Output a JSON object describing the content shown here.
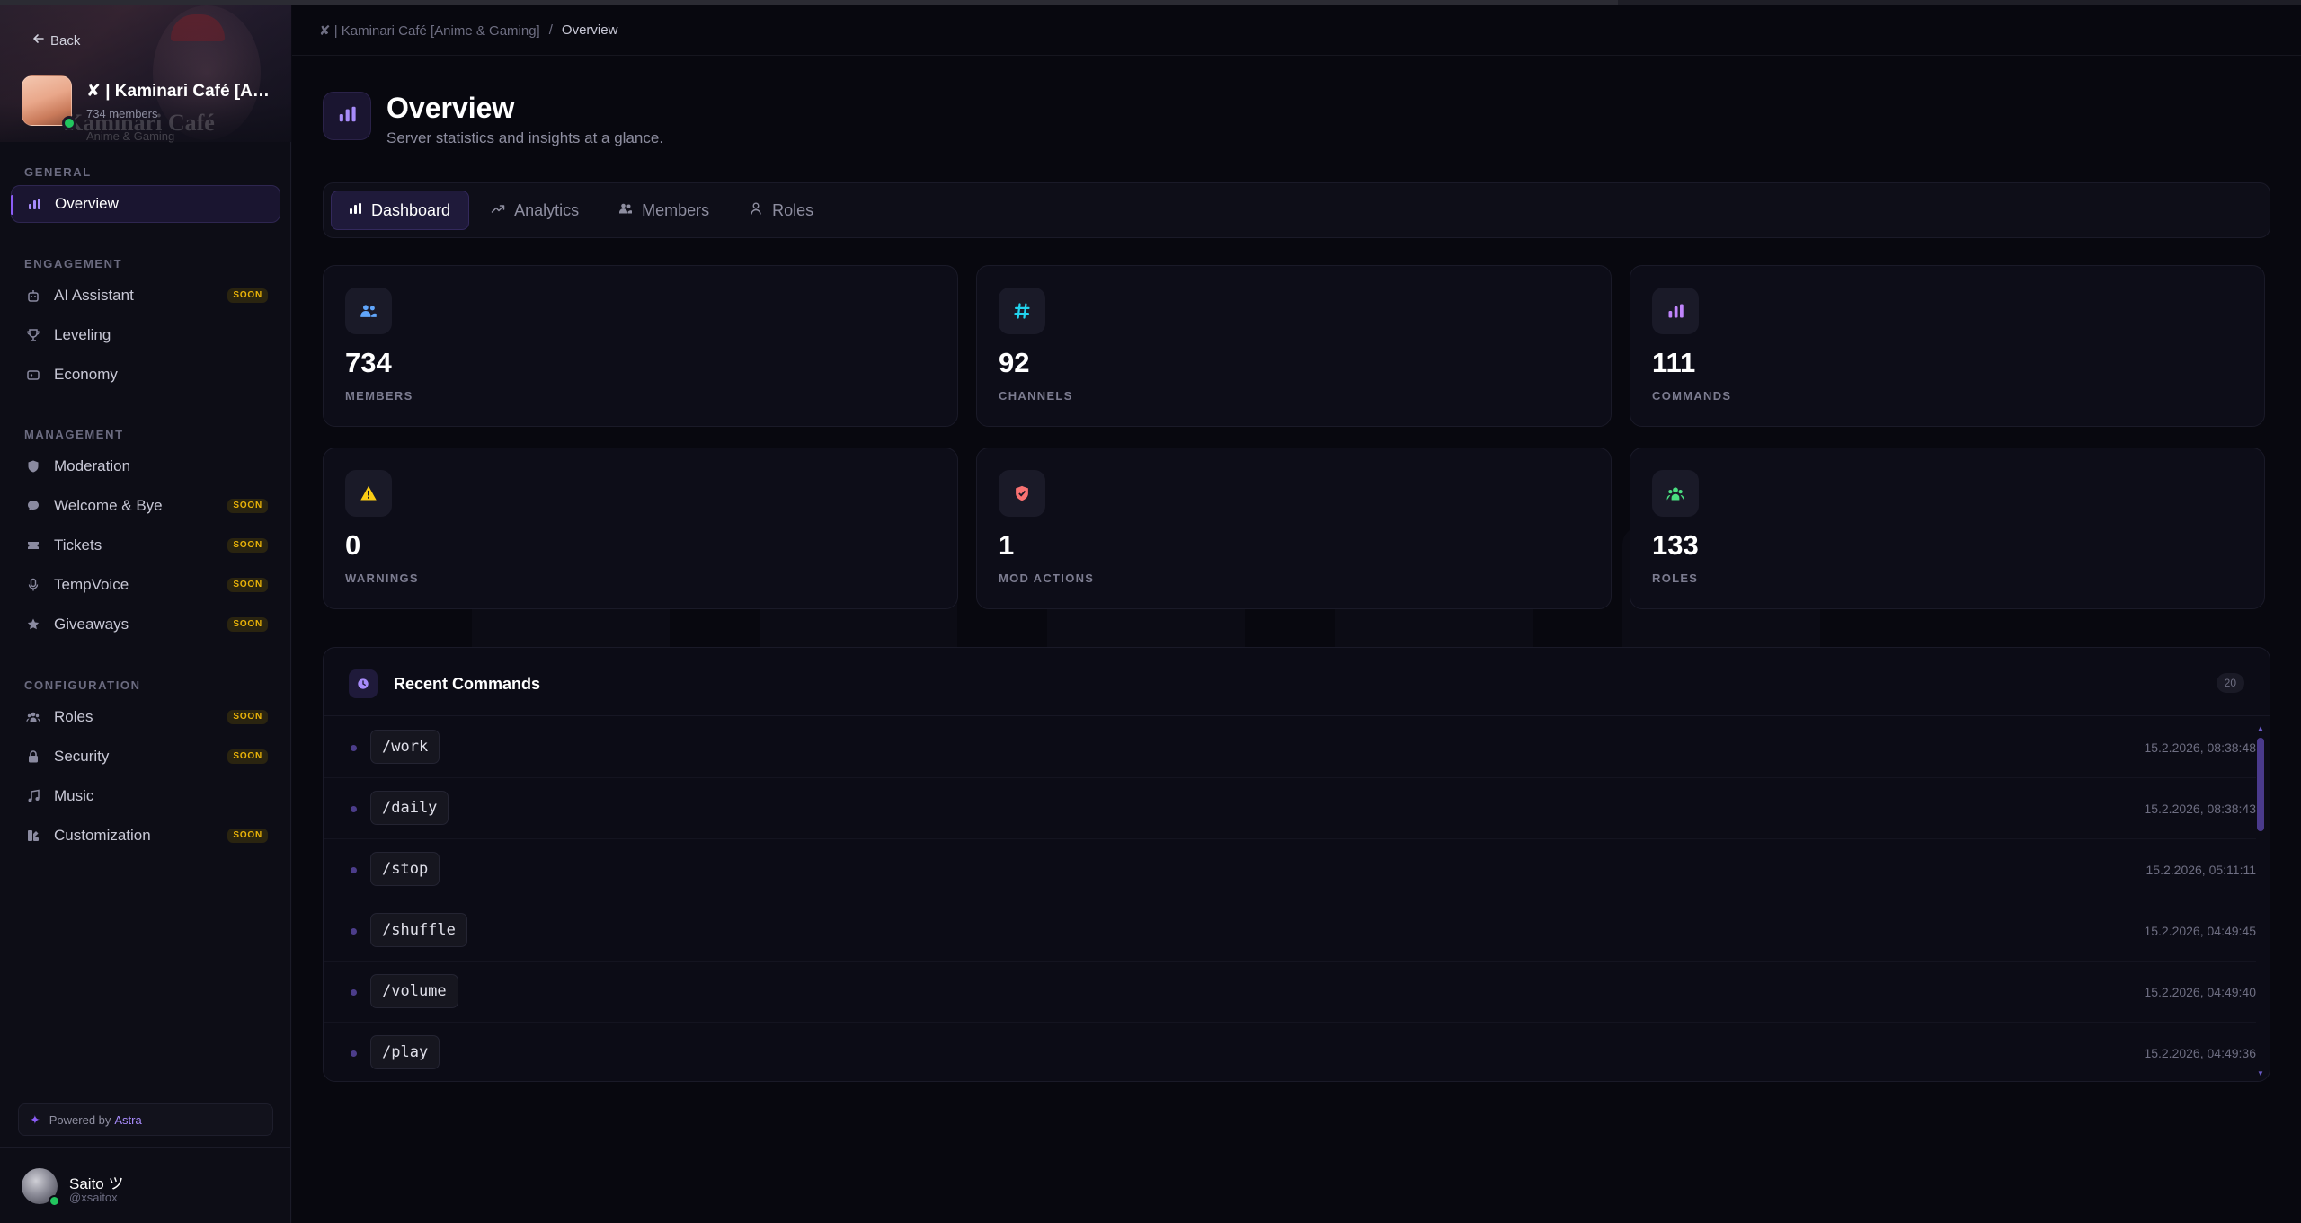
{
  "sidebar": {
    "back_label": "Back",
    "server": {
      "name": "✘ | Kaminari Café [An...",
      "members": "734 members",
      "banner_ghost_title": "Kaminari Café",
      "banner_ghost_subtitle": "Anime & Gaming"
    },
    "sections": {
      "general": "GENERAL",
      "engagement": "ENGAGEMENT",
      "management": "MANAGEMENT",
      "configuration": "CONFIGURATION"
    },
    "items": {
      "overview": "Overview",
      "ai_assistant": "AI Assistant",
      "leveling": "Leveling",
      "economy": "Economy",
      "moderation": "Moderation",
      "welcome_bye": "Welcome & Bye",
      "tickets": "Tickets",
      "tempvoice": "TempVoice",
      "giveaways": "Giveaways",
      "roles": "Roles",
      "security": "Security",
      "music": "Music",
      "customization": "Customization"
    },
    "soon_label": "SOON",
    "powered_prefix": "Powered by",
    "powered_brand": "Astra",
    "user": {
      "name": "Saito ツ",
      "handle": "@xsaitox"
    }
  },
  "breadcrumb": {
    "server": "✘ | Kaminari Café [Anime & Gaming]",
    "separator": "/",
    "current": "Overview"
  },
  "page": {
    "title": "Overview",
    "subtitle": "Server statistics and insights at a glance."
  },
  "tabs": {
    "dashboard": "Dashboard",
    "analytics": "Analytics",
    "members": "Members",
    "roles": "Roles"
  },
  "stats": {
    "members": {
      "value": "734",
      "label": "MEMBERS",
      "icon": "users-icon",
      "color": "#60a5fa"
    },
    "channels": {
      "value": "92",
      "label": "CHANNELS",
      "icon": "hash-icon",
      "color": "#22d3ee"
    },
    "commands": {
      "value": "111",
      "label": "COMMANDS",
      "icon": "bar-chart-icon",
      "color": "#c084fc"
    },
    "warnings": {
      "value": "0",
      "label": "WARNINGS",
      "icon": "warning-icon",
      "color": "#facc15"
    },
    "mod_actions": {
      "value": "1",
      "label": "MOD ACTIONS",
      "icon": "shield-icon",
      "color": "#f87171"
    },
    "roles": {
      "value": "133",
      "label": "ROLES",
      "icon": "group-icon",
      "color": "#4ade80"
    }
  },
  "recent": {
    "title": "Recent Commands",
    "count": "20",
    "rows": [
      {
        "command": "/work",
        "time": "15.2.2026, 08:38:48"
      },
      {
        "command": "/daily",
        "time": "15.2.2026, 08:38:43"
      },
      {
        "command": "/stop",
        "time": "15.2.2026, 05:11:11"
      },
      {
        "command": "/shuffle",
        "time": "15.2.2026, 04:49:45"
      },
      {
        "command": "/volume",
        "time": "15.2.2026, 04:49:40"
      },
      {
        "command": "/play",
        "time": "15.2.2026, 04:49:36"
      }
    ]
  },
  "colors": {
    "accent": "#8b5cf6",
    "soon_badge": "#eab308",
    "online": "#22c55e"
  }
}
